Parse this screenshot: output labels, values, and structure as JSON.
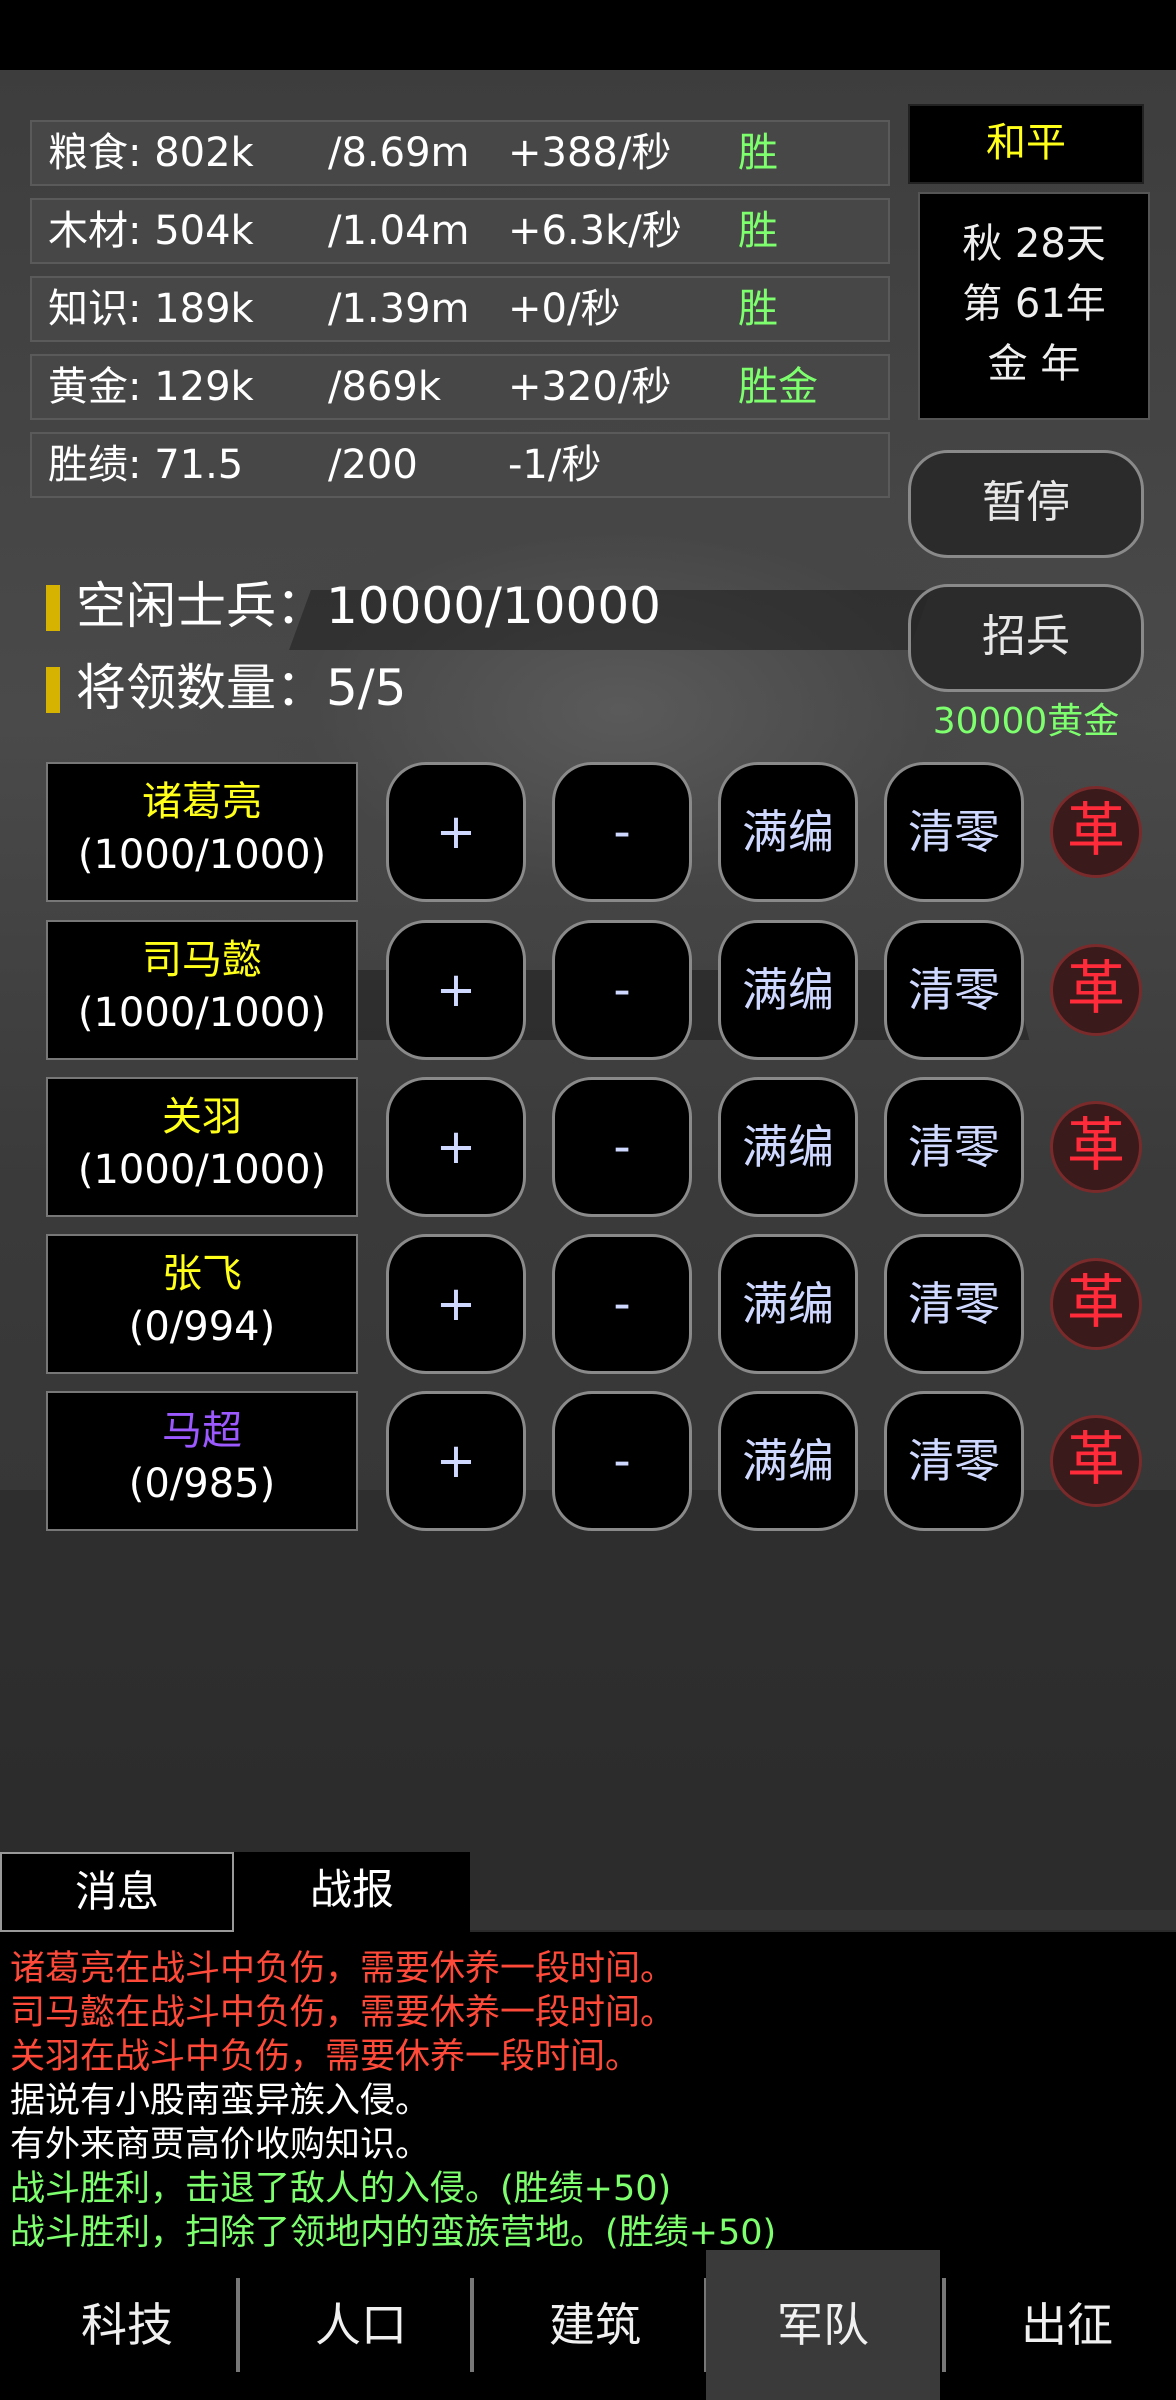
{
  "resources": [
    {
      "name": "粮食: 802k",
      "max": "/8.69m",
      "rate": "+388/秒",
      "status": "胜"
    },
    {
      "name": "木材: 504k",
      "max": "/1.04m",
      "rate": "+6.3k/秒",
      "status": "胜"
    },
    {
      "name": "知识: 189k",
      "max": "/1.39m",
      "rate": "+0/秒",
      "status": "胜"
    },
    {
      "name": "黄金: 129k",
      "max": "/869k",
      "rate": "+320/秒",
      "status": "胜金"
    },
    {
      "name": "胜绩: 71.5",
      "max": "/200",
      "rate": "-1/秒",
      "status": ""
    }
  ],
  "peace_label": "和平",
  "season": {
    "line1": "秋 28天",
    "line2": "第 61年",
    "line3": "金 年"
  },
  "pause_button": "暂停",
  "recruit_button": "招兵",
  "recruit_cost": "30000黄金",
  "idle_soldiers": "空闲士兵：10000/10000",
  "general_count": "将领数量：5/5",
  "generals": [
    {
      "name": "诸葛亮",
      "count": "(1000/1000)",
      "color": "#ffff1a"
    },
    {
      "name": "司马懿",
      "count": "(1000/1000)",
      "color": "#ffff1a"
    },
    {
      "name": "关羽",
      "count": "(1000/1000)",
      "color": "#ffff1a"
    },
    {
      "name": "张飞",
      "count": "(0/994)",
      "color": "#ffff1a"
    },
    {
      "name": "马超",
      "count": "(0/985)",
      "color": "#9b59ff"
    }
  ],
  "general_buttons": {
    "add": "+",
    "remove": "-",
    "fill": "满编",
    "clear": "清零",
    "dismiss": "革"
  },
  "tabs": {
    "messages": "消息",
    "battle_report": "战报"
  },
  "log": [
    {
      "text": "诸葛亮在战斗中负伤，需要休养一段时间。",
      "color": "#ff4a3a"
    },
    {
      "text": "司马懿在战斗中负伤，需要休养一段时间。",
      "color": "#ff4a3a"
    },
    {
      "text": "关羽在战斗中负伤，需要休养一段时间。",
      "color": "#ff4a3a"
    },
    {
      "text": "据说有小股南蛮异族入侵。",
      "color": "#ffffff"
    },
    {
      "text": "有外来商贾高价收购知识。",
      "color": "#ffffff"
    },
    {
      "text": "战斗胜利，击退了敌人的入侵。(胜绩+50)",
      "color": "#7dff6e"
    },
    {
      "text": "战斗胜利，扫除了领地内的蛮族营地。(胜绩+50)",
      "color": "#7dff6e"
    }
  ],
  "nav": [
    "科技",
    "人口",
    "建筑",
    "军队",
    "出征"
  ],
  "nav_active": "军队"
}
